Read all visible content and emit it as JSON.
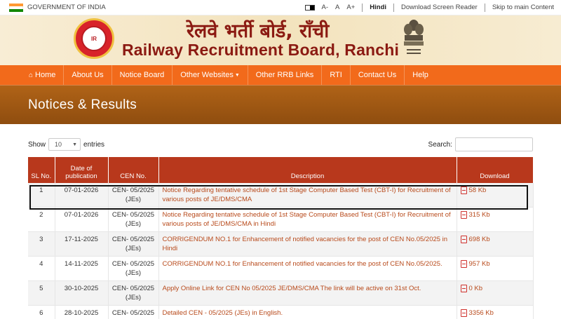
{
  "topbar": {
    "gov_label": "GOVERNMENT OF INDIA",
    "font_small": "A-",
    "font_normal": "A",
    "font_large": "A+",
    "language": "Hindi",
    "download_reader": "Download Screen Reader",
    "skip_link": "Skip to main Content"
  },
  "header": {
    "title_hindi": "रेलवे भर्ती बोर्ड, राँची",
    "title_english": "Railway Recruitment Board, Ranchi"
  },
  "nav": {
    "items": [
      "Home",
      "About Us",
      "Notice Board",
      "Other Websites",
      "Other RRB Links",
      "RTI",
      "Contact Us",
      "Help"
    ]
  },
  "banner": {
    "title": "Notices & Results"
  },
  "controls": {
    "show_label": "Show",
    "entries_value": "10",
    "entries_label": "entries",
    "search_label": "Search:",
    "search_value": ""
  },
  "table": {
    "headers": [
      "SL No.",
      "Date of publication",
      "CEN No.",
      "Description",
      "Download"
    ],
    "rows": [
      {
        "sl": "1",
        "date": "07-01-2026",
        "cen": "CEN- 05/2025 (JEs)",
        "desc": "Notice Regarding tentative schedule of 1st Stage Computer Based Test (CBT-I) for Recruitment of various posts of JE/DMS/CMA",
        "size": "58 Kb"
      },
      {
        "sl": "2",
        "date": "07-01-2026",
        "cen": "CEN- 05/2025 (JEs)",
        "desc": "Notice Regarding tentative schedule of 1st Stage Computer Based Test (CBT-I) for Recruitment of various posts of JE/DMS/CMA in Hindi",
        "size": "315 Kb"
      },
      {
        "sl": "3",
        "date": "17-11-2025",
        "cen": "CEN- 05/2025 (JEs)",
        "desc": "CORRIGENDUM NO.1 for Enhancement of notified vacancies for the post of CEN No.05/2025 in Hindi",
        "size": "698 Kb"
      },
      {
        "sl": "4",
        "date": "14-11-2025",
        "cen": "CEN- 05/2025 (JEs)",
        "desc": "CORRIGENDUM NO.1 for Enhancement of notified vacancies for the post of CEN No.05/2025.",
        "size": "957 Kb"
      },
      {
        "sl": "5",
        "date": "30-10-2025",
        "cen": "CEN- 05/2025 (JEs)",
        "desc": "Apply Online Link for CEN No 05/2025 JE/DMS/CMA The link will be active on 31st Oct.",
        "size": "0 Kb"
      },
      {
        "sl": "6",
        "date": "28-10-2025",
        "cen": "CEN- 05/2025",
        "desc": "Detailed CEN - 05/2025 (JEs) in English.",
        "size": "3356 Kb"
      }
    ]
  }
}
